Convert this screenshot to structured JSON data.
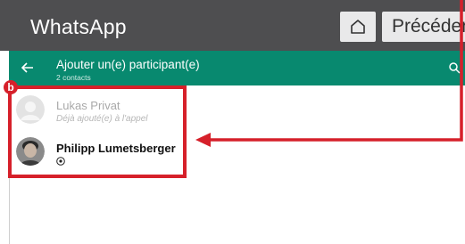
{
  "app": {
    "title": "WhatsApp",
    "home_icon": "home-icon",
    "prev_label": "Précédent"
  },
  "header": {
    "back_icon": "back-arrow-icon",
    "title": "Ajouter un(e) participant(e)",
    "subtitle": "2 contacts",
    "search_icon": "search-icon",
    "color": "#08896f"
  },
  "contacts": [
    {
      "name": "Lukas Privat",
      "status": "Déjà ajouté(e) à l'appel"
    },
    {
      "name": "Philipp Lumetsberger",
      "status_icon": "soccer-ball-icon"
    }
  ],
  "annotation": {
    "badge": "b",
    "color": "#d6202a"
  }
}
